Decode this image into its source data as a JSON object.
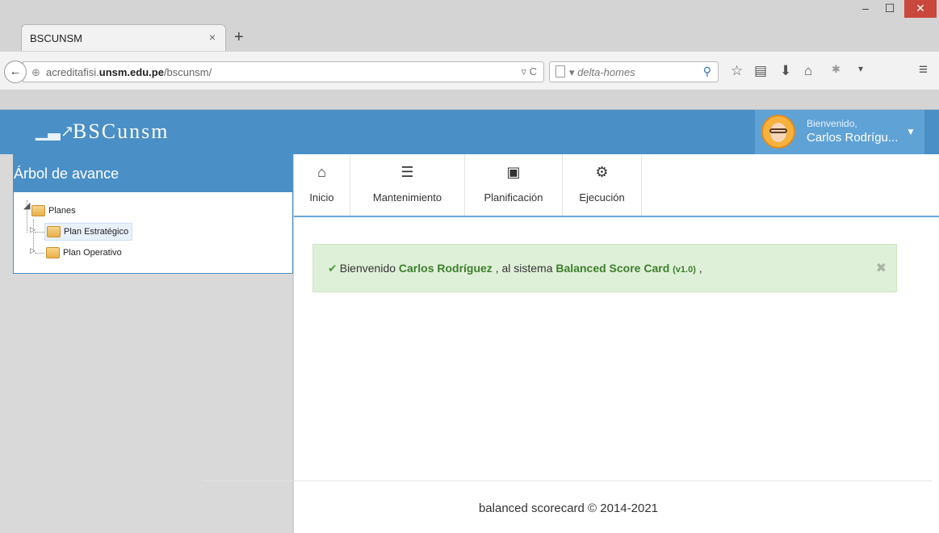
{
  "browser": {
    "tab_title": "BSCUNSM",
    "tab_close": "×",
    "new_tab": "+",
    "window": {
      "minimize": "–",
      "maximize": "☐",
      "close": "✕"
    },
    "url_host_prefix": "acreditafisi.",
    "url_host": "unsm.edu.pe",
    "url_path": "/bscunsm/",
    "url_tools": "▿ C",
    "search_text": "▾ delta-homes",
    "toolbar_icons": [
      "star-icon",
      "bookmarks-icon",
      "download-icon",
      "home-icon",
      "addon-icon",
      "menu-icon"
    ]
  },
  "header": {
    "logo_text": "BSCunsm",
    "greeting": "Bienvenido,",
    "user_name": "Carlos Rodrígu...",
    "colors": {
      "header_bg": "#4a8fc6",
      "user_bg": "#5fa2d6"
    }
  },
  "sidebar": {
    "title": "Árbol de avance",
    "tree": [
      {
        "label": "Planes",
        "expanded": true
      },
      {
        "label": "Plan Estratégico",
        "selected": true
      },
      {
        "label": "Plan Operativo"
      }
    ]
  },
  "menu": {
    "items": [
      {
        "label": "Inicio",
        "icon": "home-icon"
      },
      {
        "label": "Mantenimiento",
        "icon": "database-icon"
      },
      {
        "label": "Planificación",
        "icon": "fax-icon"
      },
      {
        "label": "Ejecución",
        "icon": "cogs-icon"
      }
    ]
  },
  "alert": {
    "prefix": "Bienvenido",
    "user": "Carlos Rodríguez",
    "middle": ", al sistema",
    "system": "Balanced Score Card",
    "version": "(v1.0)",
    "suffix": ",",
    "close": "✖",
    "color": "#dff0d8"
  },
  "footer": {
    "text": "balanced scorecard © 2014-2021"
  }
}
